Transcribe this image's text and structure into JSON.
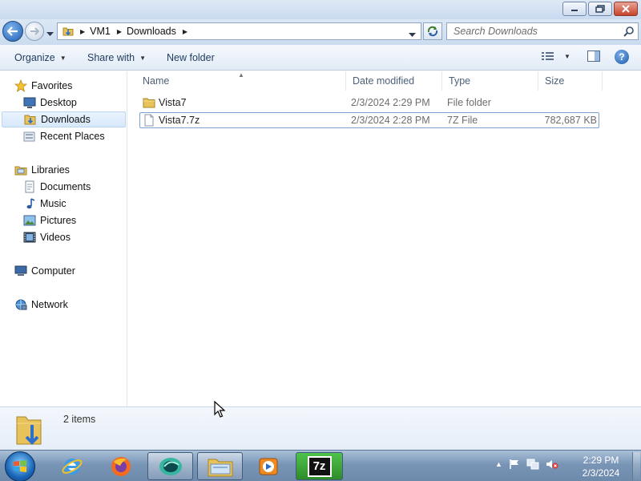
{
  "window": {
    "buttons": {
      "minimize_icon": "minimize-icon",
      "maximize_icon": "restore-icon",
      "close_icon": "close-icon"
    }
  },
  "address": {
    "breadcrumb": [
      "VM1",
      "Downloads"
    ],
    "search_placeholder": "Search Downloads"
  },
  "commandbar": {
    "organize": "Organize",
    "share_with": "Share with",
    "new_folder": "New folder",
    "help": "?"
  },
  "navpane": {
    "favorites": {
      "label": "Favorites",
      "items": [
        "Desktop",
        "Downloads",
        "Recent Places"
      ]
    },
    "libraries": {
      "label": "Libraries",
      "items": [
        "Documents",
        "Music",
        "Pictures",
        "Videos"
      ]
    },
    "computer": "Computer",
    "network": "Network",
    "selected": "Downloads"
  },
  "content": {
    "columns": {
      "name": "Name",
      "date_modified": "Date modified",
      "type": "Type",
      "size": "Size"
    },
    "files": [
      {
        "name": "Vista7",
        "date_modified": "2/3/2024 2:29 PM",
        "type": "File folder",
        "size": "",
        "icon": "folder-icon"
      },
      {
        "name": "Vista7.7z",
        "date_modified": "2/3/2024 2:28 PM",
        "type": "7Z File",
        "size": "782,687 KB",
        "icon": "file-icon"
      }
    ]
  },
  "details": {
    "count": "2 items"
  },
  "taskbar": {
    "apps": [
      "internet-explorer-icon",
      "firefox-icon",
      "app-icon",
      "explorer-icon",
      "media-player-icon",
      "7zip-icon"
    ],
    "seven_zip_label": "7z",
    "clock_time": "2:29 PM",
    "clock_date": "2/3/2024"
  },
  "colors": {
    "accent": "#1c5aa8",
    "selection": "#d7e8fb",
    "taskbar": "#7995b6"
  }
}
